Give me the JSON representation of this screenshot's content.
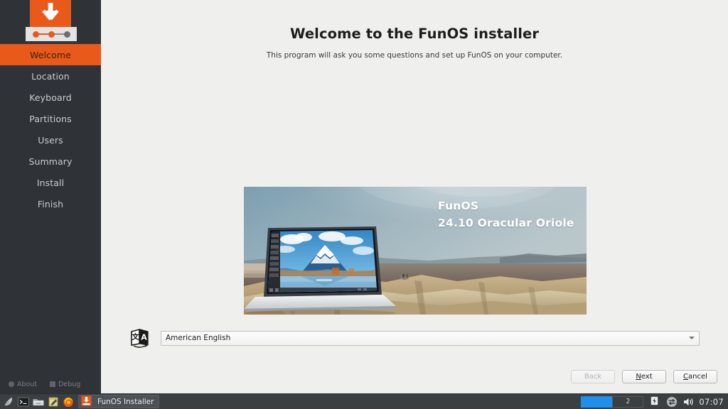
{
  "installer": {
    "window_title": "FunOS Installer",
    "title": "Welcome to the FunOS installer",
    "subtitle": "This program will ask you some questions and set up FunOS on your computer.",
    "accent_color": "#e9591a",
    "sidebar_color": "#2f3338",
    "page_background": "#efefed"
  },
  "sidebar": {
    "logo_icon": "download-arrow-icon",
    "progress_icon": "progress-dots-icon",
    "steps": [
      {
        "label": "Welcome",
        "active": true
      },
      {
        "label": "Location",
        "active": false
      },
      {
        "label": "Keyboard",
        "active": false
      },
      {
        "label": "Partitions",
        "active": false
      },
      {
        "label": "Users",
        "active": false
      },
      {
        "label": "Summary",
        "active": false
      },
      {
        "label": "Install",
        "active": false
      },
      {
        "label": "Finish",
        "active": false
      }
    ],
    "about_label": "About",
    "debug_label": "Debug"
  },
  "banner": {
    "os_name": "FunOS",
    "version_line": "24.10 Oracular Oriole",
    "scene": "laptop-on-desert-landscape"
  },
  "language": {
    "icon": "translate-icon",
    "selected": "American English",
    "placeholder": "American English"
  },
  "footer": {
    "back_label": "Back",
    "back_enabled": false,
    "next_label": "Next",
    "next_accesskey": "N",
    "cancel_label": "Cancel",
    "cancel_accesskey": "C"
  },
  "taskbar": {
    "launchers": [
      {
        "name": "whisker-menu-icon"
      },
      {
        "name": "terminal-icon"
      },
      {
        "name": "file-manager-icon"
      },
      {
        "name": "text-editor-icon"
      },
      {
        "name": "firefox-icon"
      }
    ],
    "task_label": "FunOS Installer",
    "task_icon": "funos-installer-icon",
    "workspaces": [
      {
        "label": "",
        "active": true
      },
      {
        "label": "2",
        "active": false
      }
    ],
    "tray": [
      {
        "name": "power-manager-icon"
      },
      {
        "name": "network-icon"
      },
      {
        "name": "volume-icon"
      }
    ],
    "clock": "07:07"
  }
}
